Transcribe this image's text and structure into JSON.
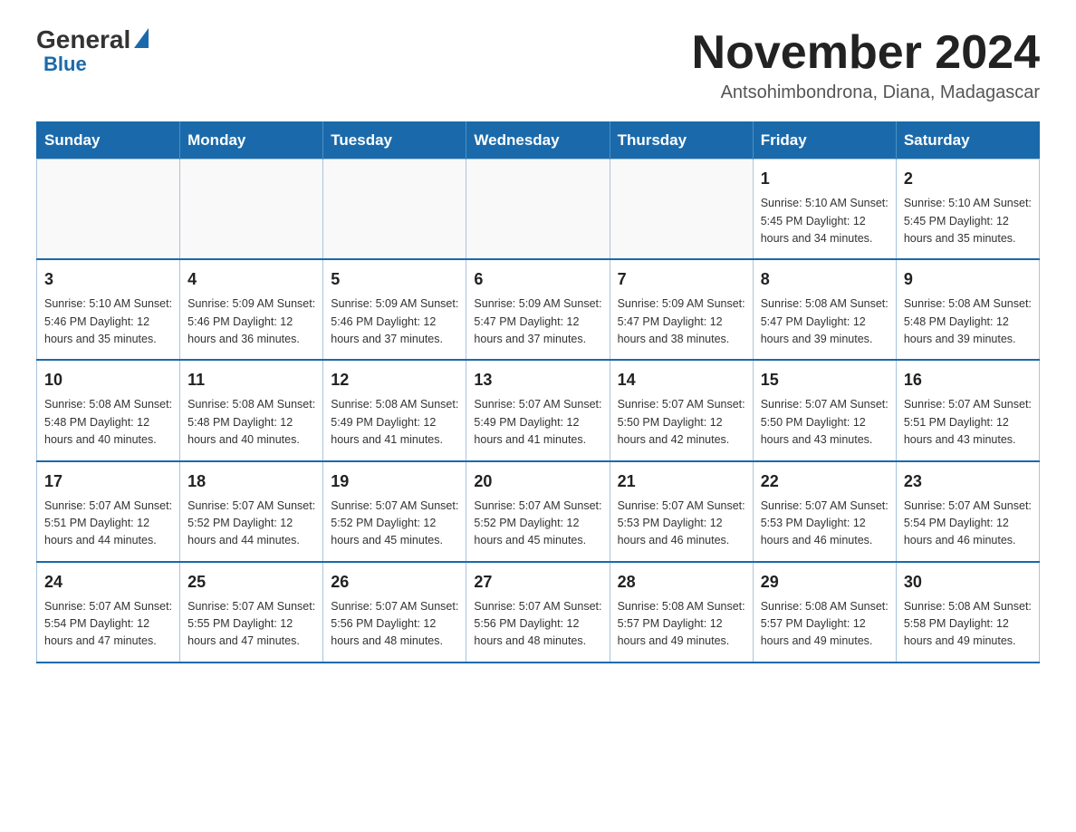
{
  "logo": {
    "general": "General",
    "blue": "Blue"
  },
  "header": {
    "month_year": "November 2024",
    "location": "Antsohimbondrona, Diana, Madagascar"
  },
  "days_of_week": [
    "Sunday",
    "Monday",
    "Tuesday",
    "Wednesday",
    "Thursday",
    "Friday",
    "Saturday"
  ],
  "weeks": [
    [
      {
        "day": "",
        "info": ""
      },
      {
        "day": "",
        "info": ""
      },
      {
        "day": "",
        "info": ""
      },
      {
        "day": "",
        "info": ""
      },
      {
        "day": "",
        "info": ""
      },
      {
        "day": "1",
        "info": "Sunrise: 5:10 AM\nSunset: 5:45 PM\nDaylight: 12 hours\nand 34 minutes."
      },
      {
        "day": "2",
        "info": "Sunrise: 5:10 AM\nSunset: 5:45 PM\nDaylight: 12 hours\nand 35 minutes."
      }
    ],
    [
      {
        "day": "3",
        "info": "Sunrise: 5:10 AM\nSunset: 5:46 PM\nDaylight: 12 hours\nand 35 minutes."
      },
      {
        "day": "4",
        "info": "Sunrise: 5:09 AM\nSunset: 5:46 PM\nDaylight: 12 hours\nand 36 minutes."
      },
      {
        "day": "5",
        "info": "Sunrise: 5:09 AM\nSunset: 5:46 PM\nDaylight: 12 hours\nand 37 minutes."
      },
      {
        "day": "6",
        "info": "Sunrise: 5:09 AM\nSunset: 5:47 PM\nDaylight: 12 hours\nand 37 minutes."
      },
      {
        "day": "7",
        "info": "Sunrise: 5:09 AM\nSunset: 5:47 PM\nDaylight: 12 hours\nand 38 minutes."
      },
      {
        "day": "8",
        "info": "Sunrise: 5:08 AM\nSunset: 5:47 PM\nDaylight: 12 hours\nand 39 minutes."
      },
      {
        "day": "9",
        "info": "Sunrise: 5:08 AM\nSunset: 5:48 PM\nDaylight: 12 hours\nand 39 minutes."
      }
    ],
    [
      {
        "day": "10",
        "info": "Sunrise: 5:08 AM\nSunset: 5:48 PM\nDaylight: 12 hours\nand 40 minutes."
      },
      {
        "day": "11",
        "info": "Sunrise: 5:08 AM\nSunset: 5:48 PM\nDaylight: 12 hours\nand 40 minutes."
      },
      {
        "day": "12",
        "info": "Sunrise: 5:08 AM\nSunset: 5:49 PM\nDaylight: 12 hours\nand 41 minutes."
      },
      {
        "day": "13",
        "info": "Sunrise: 5:07 AM\nSunset: 5:49 PM\nDaylight: 12 hours\nand 41 minutes."
      },
      {
        "day": "14",
        "info": "Sunrise: 5:07 AM\nSunset: 5:50 PM\nDaylight: 12 hours\nand 42 minutes."
      },
      {
        "day": "15",
        "info": "Sunrise: 5:07 AM\nSunset: 5:50 PM\nDaylight: 12 hours\nand 43 minutes."
      },
      {
        "day": "16",
        "info": "Sunrise: 5:07 AM\nSunset: 5:51 PM\nDaylight: 12 hours\nand 43 minutes."
      }
    ],
    [
      {
        "day": "17",
        "info": "Sunrise: 5:07 AM\nSunset: 5:51 PM\nDaylight: 12 hours\nand 44 minutes."
      },
      {
        "day": "18",
        "info": "Sunrise: 5:07 AM\nSunset: 5:52 PM\nDaylight: 12 hours\nand 44 minutes."
      },
      {
        "day": "19",
        "info": "Sunrise: 5:07 AM\nSunset: 5:52 PM\nDaylight: 12 hours\nand 45 minutes."
      },
      {
        "day": "20",
        "info": "Sunrise: 5:07 AM\nSunset: 5:52 PM\nDaylight: 12 hours\nand 45 minutes."
      },
      {
        "day": "21",
        "info": "Sunrise: 5:07 AM\nSunset: 5:53 PM\nDaylight: 12 hours\nand 46 minutes."
      },
      {
        "day": "22",
        "info": "Sunrise: 5:07 AM\nSunset: 5:53 PM\nDaylight: 12 hours\nand 46 minutes."
      },
      {
        "day": "23",
        "info": "Sunrise: 5:07 AM\nSunset: 5:54 PM\nDaylight: 12 hours\nand 46 minutes."
      }
    ],
    [
      {
        "day": "24",
        "info": "Sunrise: 5:07 AM\nSunset: 5:54 PM\nDaylight: 12 hours\nand 47 minutes."
      },
      {
        "day": "25",
        "info": "Sunrise: 5:07 AM\nSunset: 5:55 PM\nDaylight: 12 hours\nand 47 minutes."
      },
      {
        "day": "26",
        "info": "Sunrise: 5:07 AM\nSunset: 5:56 PM\nDaylight: 12 hours\nand 48 minutes."
      },
      {
        "day": "27",
        "info": "Sunrise: 5:07 AM\nSunset: 5:56 PM\nDaylight: 12 hours\nand 48 minutes."
      },
      {
        "day": "28",
        "info": "Sunrise: 5:08 AM\nSunset: 5:57 PM\nDaylight: 12 hours\nand 49 minutes."
      },
      {
        "day": "29",
        "info": "Sunrise: 5:08 AM\nSunset: 5:57 PM\nDaylight: 12 hours\nand 49 minutes."
      },
      {
        "day": "30",
        "info": "Sunrise: 5:08 AM\nSunset: 5:58 PM\nDaylight: 12 hours\nand 49 minutes."
      }
    ]
  ]
}
